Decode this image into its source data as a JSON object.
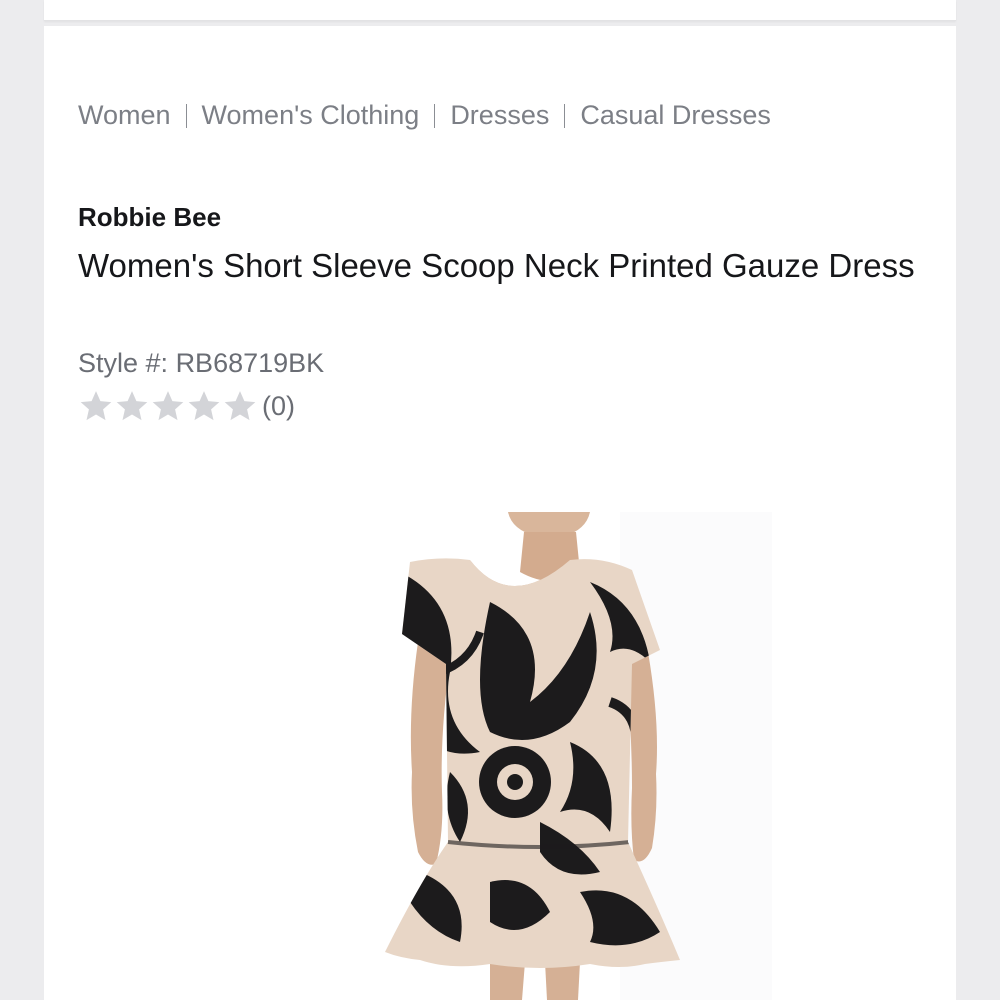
{
  "breadcrumb": [
    "Women",
    "Women's Clothing",
    "Dresses",
    "Casual Dresses"
  ],
  "product": {
    "brand": "Robbie Bee",
    "title": "Women's Short Sleeve Scoop Neck Printed Gauze Dress",
    "style_label": "Style #:",
    "style_number": "RB68719BK",
    "rating": {
      "stars_filled": 0,
      "stars_total": 5,
      "review_count": "(0)"
    }
  },
  "icons": {
    "star": "star-icon"
  },
  "colors": {
    "text_primary": "#16171a",
    "text_secondary": "#7c7f86",
    "star_empty": "#d3d4d8",
    "dress_dark": "#1c1b1c",
    "dress_light": "#e8d6c6",
    "skin": "#d9b69b"
  }
}
